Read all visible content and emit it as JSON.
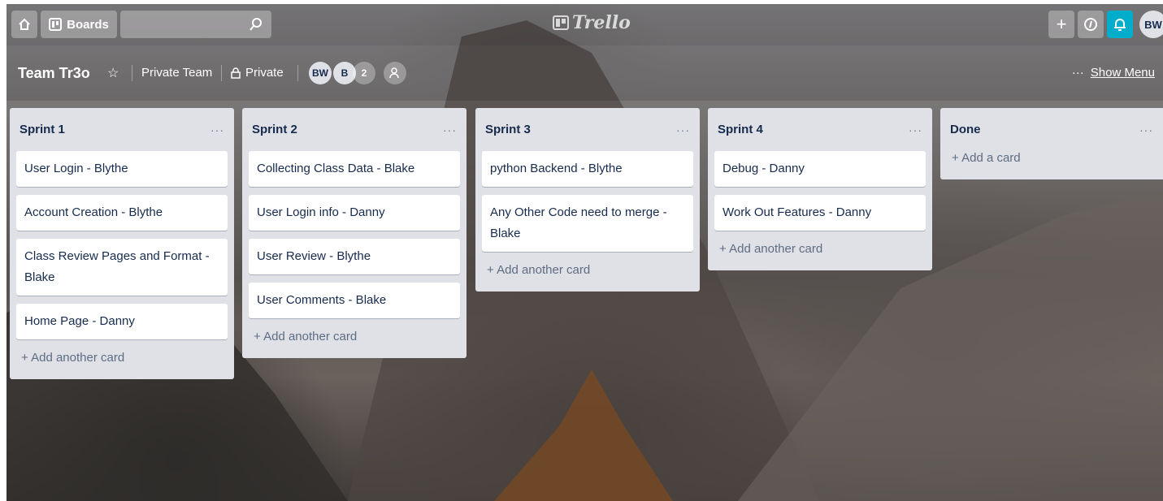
{
  "header": {
    "boards_label": "Boards",
    "logo_text": "Trello",
    "user_initials": "BW"
  },
  "board": {
    "title": "Team Tr3o",
    "team": "Private Team",
    "visibility": "Private",
    "members": [
      "BW",
      "B"
    ],
    "extra_member_count": "2",
    "show_menu_label": "Show Menu",
    "more_label": "···"
  },
  "lists": [
    {
      "title": "Sprint 1",
      "cards": [
        "User Login - Blythe",
        "Account Creation - Blythe",
        "Class Review Pages and Format - Blake",
        "Home Page - Danny"
      ],
      "add_label": "+ Add another card"
    },
    {
      "title": "Sprint 2",
      "cards": [
        "Collecting Class Data - Blake",
        "User Login info - Danny",
        "User Review - Blythe",
        "User Comments - Blake"
      ],
      "add_label": "+ Add another card"
    },
    {
      "title": "Sprint 3",
      "cards": [
        "python Backend - Blythe",
        "Any Other Code need to merge - Blake"
      ],
      "add_label": "+ Add another card"
    },
    {
      "title": "Sprint 4",
      "cards": [
        "Debug - Danny",
        "Work Out Features - Danny"
      ],
      "add_label": "+ Add another card"
    },
    {
      "title": "Done",
      "cards": [],
      "add_label": "+ Add a card"
    }
  ],
  "list_menu_label": "···",
  "colors": {
    "accent_notification": "#00aecc",
    "list_bg": "#dfe1e6",
    "card_text": "#172b4d"
  }
}
